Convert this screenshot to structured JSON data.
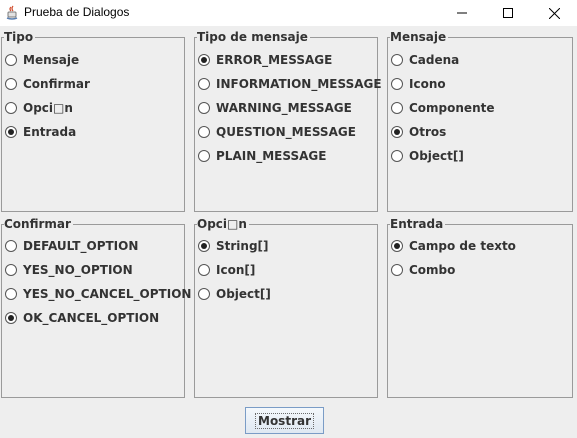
{
  "window": {
    "title": "Prueba de Dialogos",
    "minimize_icon": "minimize-icon",
    "maximize_icon": "maximize-icon",
    "close_icon": "close-icon"
  },
  "panels": {
    "tipo": {
      "title": "Tipo",
      "options": [
        {
          "label": "Mensaje",
          "checked": false
        },
        {
          "label": "Confirmar",
          "checked": false
        },
        {
          "label": "Opci□n",
          "checked": false
        },
        {
          "label": "Entrada",
          "checked": true
        }
      ]
    },
    "tipo_mensaje": {
      "title": "Tipo de mensaje",
      "options": [
        {
          "label": "ERROR_MESSAGE",
          "checked": true
        },
        {
          "label": "INFORMATION_MESSAGE",
          "checked": false
        },
        {
          "label": "WARNING_MESSAGE",
          "checked": false
        },
        {
          "label": "QUESTION_MESSAGE",
          "checked": false
        },
        {
          "label": "PLAIN_MESSAGE",
          "checked": false
        }
      ]
    },
    "mensaje": {
      "title": "Mensaje",
      "options": [
        {
          "label": "Cadena",
          "checked": false
        },
        {
          "label": "Icono",
          "checked": false
        },
        {
          "label": "Componente",
          "checked": false
        },
        {
          "label": "Otros",
          "checked": true
        },
        {
          "label": "Object[]",
          "checked": false
        }
      ]
    },
    "confirmar": {
      "title": "Confirmar",
      "options": [
        {
          "label": "DEFAULT_OPTION",
          "checked": false
        },
        {
          "label": "YES_NO_OPTION",
          "checked": false
        },
        {
          "label": "YES_NO_CANCEL_OPTION",
          "checked": false
        },
        {
          "label": "OK_CANCEL_OPTION",
          "checked": true
        }
      ]
    },
    "opcion": {
      "title": "Opci□n",
      "options": [
        {
          "label": "String[]",
          "checked": true
        },
        {
          "label": "Icon[]",
          "checked": false
        },
        {
          "label": "Object[]",
          "checked": false
        }
      ]
    },
    "entrada": {
      "title": "Entrada",
      "options": [
        {
          "label": "Campo de texto",
          "checked": true
        },
        {
          "label": "Combo",
          "checked": false
        }
      ]
    }
  },
  "actions": {
    "show_label": "Mostrar"
  }
}
